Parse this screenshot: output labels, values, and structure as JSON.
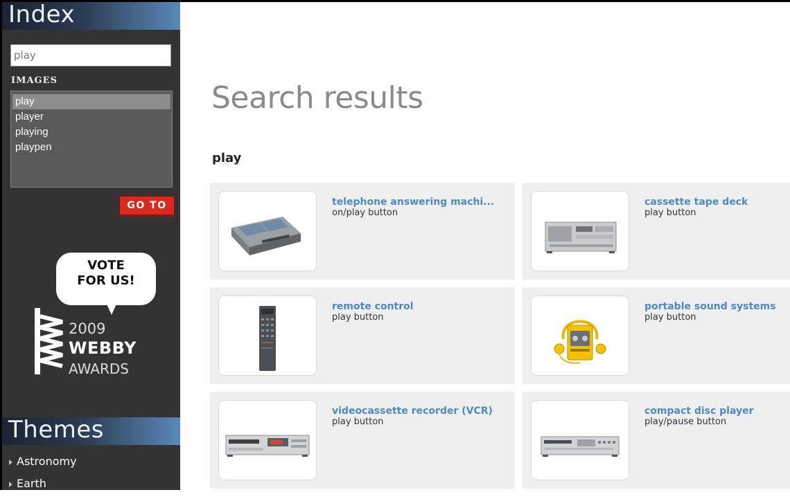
{
  "sidebar": {
    "index_title": "Index",
    "search_value": "play",
    "images_label": "IMAGES",
    "image_list": [
      "play",
      "player",
      "playing",
      "playpen"
    ],
    "goto_label": "GO TO",
    "vote": {
      "line1": "VOTE",
      "line2": "FOR US!"
    },
    "webby": {
      "year": "2009",
      "name": "WEBBY",
      "awards": "AWARDS"
    },
    "themes_title": "Themes",
    "themes": [
      "Astronomy",
      "Earth"
    ]
  },
  "main": {
    "title": "Search results",
    "query": "play",
    "results": [
      {
        "title": "telephone answering machi...",
        "subtitle": "on/play button",
        "icon": "answering-machine-image"
      },
      {
        "title": "cassette tape deck",
        "subtitle": "play button",
        "icon": "cassette-deck-image"
      },
      {
        "title": "remote control",
        "subtitle": "play button",
        "icon": "remote-control-image"
      },
      {
        "title": "portable sound systems",
        "subtitle": "play button",
        "icon": "portable-cassette-player-image"
      },
      {
        "title": "videocassette recorder (VCR)",
        "subtitle": "play button",
        "icon": "vcr-image"
      },
      {
        "title": "compact disc player",
        "subtitle": "play/pause button",
        "icon": "cd-player-image"
      }
    ]
  },
  "colors": {
    "sidebar_bg": "#333333",
    "link": "#4f89c2",
    "goto_button": "#d8291f",
    "card_bg": "#efefef"
  }
}
